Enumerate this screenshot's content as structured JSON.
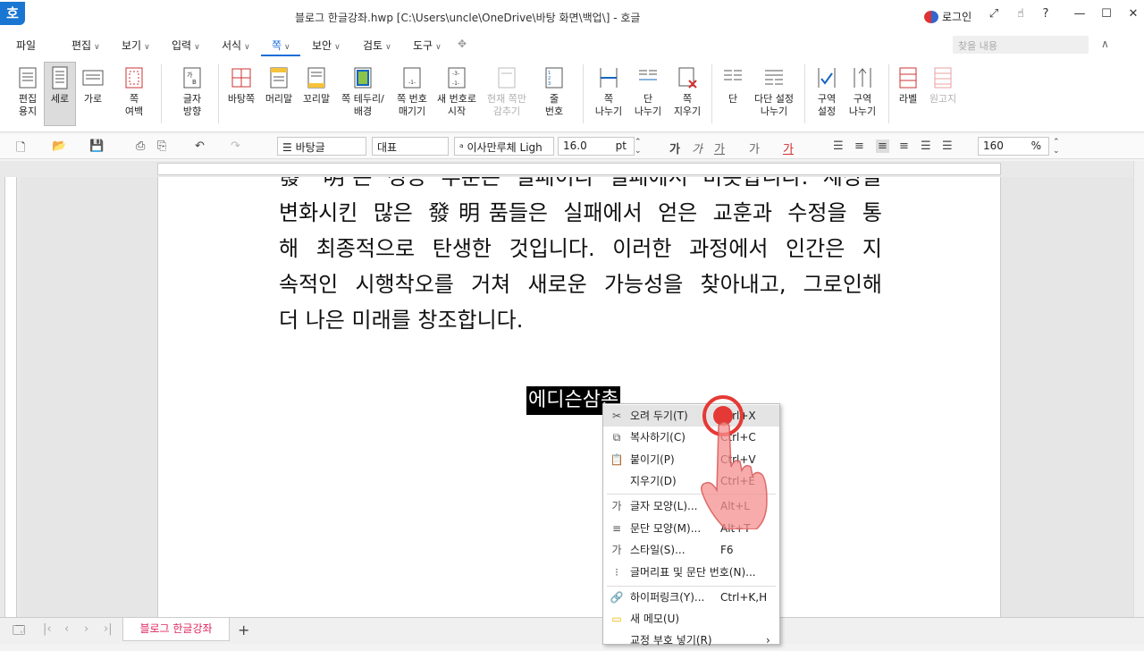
{
  "window": {
    "logo": "호",
    "title": "블로그 한글강좌.hwp [C:\\Users\\uncle\\OneDrive\\바탕 화면\\백업\\] - 호글",
    "login": "로그인"
  },
  "menu": {
    "items": [
      "파일",
      "편집",
      "보기",
      "입력",
      "서식",
      "쪽",
      "보안",
      "검토",
      "도구"
    ],
    "search_placeholder": "찾을 내용"
  },
  "ribbon": {
    "buttons": [
      "편집\n용지",
      "세로",
      "가로",
      "쪽\n여백",
      "글자\n방향",
      "바탕쪽",
      "머리말",
      "꼬리말",
      "쪽 테두리/\n배경",
      "쪽 번호\n매기기",
      "새 번호로\n시작",
      "현재 쪽만\n감추기",
      "줄\n번호",
      "쪽\n나누기",
      "단\n나누기",
      "쪽\n지우기",
      "단",
      "다단 설정\n나누기",
      "구역\n설정",
      "구역\n나누기",
      "라벨",
      "원고지"
    ]
  },
  "toolbar": {
    "style": "바탕글",
    "lang": "대표",
    "font": "이사만루체 Ligh",
    "size": "16.0",
    "unit": "pt",
    "zoom": "160",
    "zoom_unit": "%"
  },
  "document": {
    "line0": "發 明은 성공 부분은 실패이다 실패에서 비롯합니다. 세상을",
    "line1": "변화시킨 많은 發明품들은 실패에서 얻은 교훈과 수정을 통",
    "line2": "해 최종적으로 탄생한 것입니다. 이러한 과정에서 인간은 지",
    "line3": "속적인 시행착오를 거쳐 새로운 가능성을 찾아내고, 그로인해",
    "line4": "더 나은 미래를 창조합니다.",
    "selected": "에디슨삼촌"
  },
  "context_menu": {
    "items": [
      {
        "icon": "✂",
        "label": "오려 두기(T)",
        "key": "Ctrl+X"
      },
      {
        "icon": "⧉",
        "label": "복사하기(C)",
        "key": "Ctrl+C"
      },
      {
        "icon": "📋",
        "label": "붙이기(P)",
        "key": "Ctrl+V"
      },
      {
        "icon": "",
        "label": "지우기(D)",
        "key": "Ctrl+E"
      },
      {
        "icon": "가",
        "label": "글자 모양(L)...",
        "key": "Alt+L"
      },
      {
        "icon": "≡",
        "label": "문단 모양(M)...",
        "key": "Alt+T"
      },
      {
        "icon": "가",
        "label": "스타일(S)...",
        "key": "F6"
      },
      {
        "icon": "⁝",
        "label": "글머리표 및 문단 번호(N)...",
        "key": ""
      },
      {
        "icon": "🔗",
        "label": "하이퍼링크(Y)...",
        "key": "Ctrl+K,H"
      },
      {
        "icon": "▭",
        "label": "새 메모(U)",
        "key": ""
      },
      {
        "icon": "",
        "label": "교정 부호 넣기(R)",
        "key": "›"
      }
    ]
  },
  "statusbar": {
    "tab": "블로그 한글강좌",
    "add": "+"
  }
}
